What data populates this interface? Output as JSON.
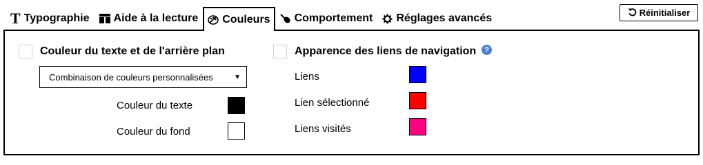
{
  "tabs": [
    {
      "label": "Typographie",
      "icon": "T"
    },
    {
      "label": "Aide à la lecture",
      "icon": "book-icon"
    },
    {
      "label": "Couleurs",
      "icon": "palette-icon",
      "active": true
    },
    {
      "label": "Comportement",
      "icon": "pointer-icon"
    },
    {
      "label": "Réglages avancés",
      "icon": "gear-icon"
    }
  ],
  "reset_button": {
    "label": "Réinitialiser",
    "icon": "undo-icon"
  },
  "text_colors": {
    "title": "Couleur du texte et de l'arrière plan",
    "checked": false,
    "select_value": "Combinaison de couleurs personnalisées",
    "text_color_label": "Couleur du texte",
    "text_color_value": "#000000",
    "background_color_label": "Couleur du fond",
    "background_color_value": "#ffffff"
  },
  "link_colors": {
    "title": "Apparence des liens de navigation",
    "checked": false,
    "help_icon": "question-circle-icon",
    "help_color": "#4a7fd4",
    "links_label": "Liens",
    "links_color": "#0000ff",
    "selected_label": "Lien sélectionné",
    "selected_color": "#ff0000",
    "visited_label": "Liens visités",
    "visited_color": "#ff0080"
  }
}
